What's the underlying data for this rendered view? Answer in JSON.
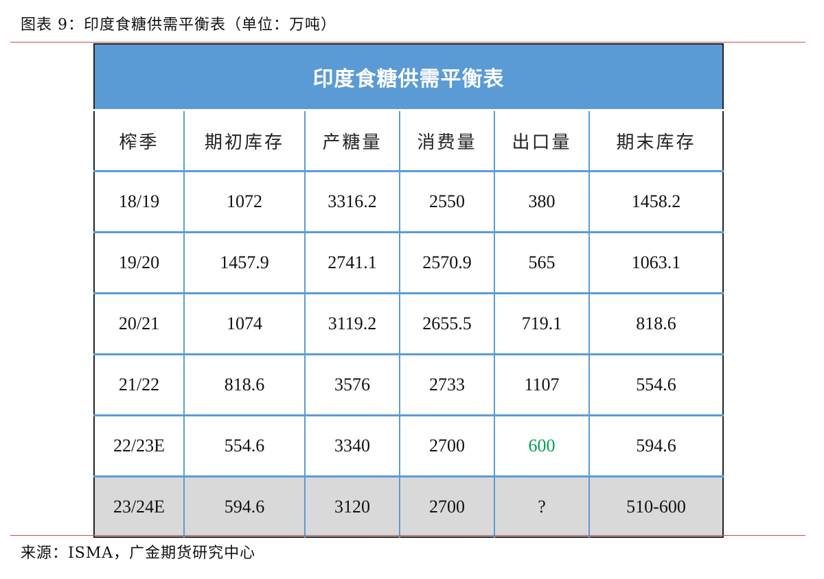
{
  "figure_title": "图表 9：印度食糖供需平衡表（单位：万吨）",
  "table": {
    "banner": "印度食糖供需平衡表",
    "headers": [
      "榨季",
      "期初库存",
      "产糖量",
      "消费量",
      "出口量",
      "期末库存"
    ],
    "rows": [
      [
        "18/19",
        "1072",
        "3316.2",
        "2550",
        "380",
        "1458.2"
      ],
      [
        "19/20",
        "1457.9",
        "2741.1",
        "2570.9",
        "565",
        "1063.1"
      ],
      [
        "20/21",
        "1074",
        "3119.2",
        "2655.5",
        "719.1",
        "818.6"
      ],
      [
        "21/22",
        "818.6",
        "3576",
        "2733",
        "1107",
        "554.6"
      ],
      [
        "22/23E",
        "554.6",
        "3340",
        "2700",
        "600",
        "594.6"
      ],
      [
        "23/24E",
        "594.6",
        "3120",
        "2700",
        "?",
        "510-600"
      ]
    ]
  },
  "source": "来源：ISMA，广金期货研究中心",
  "colors": {
    "banner_bg": "#5b9bd5",
    "grid": "#5b9bd5",
    "rule": "#c0504d",
    "highlight_text": "#00a050",
    "last_row_bg": "#d9d9d9"
  }
}
